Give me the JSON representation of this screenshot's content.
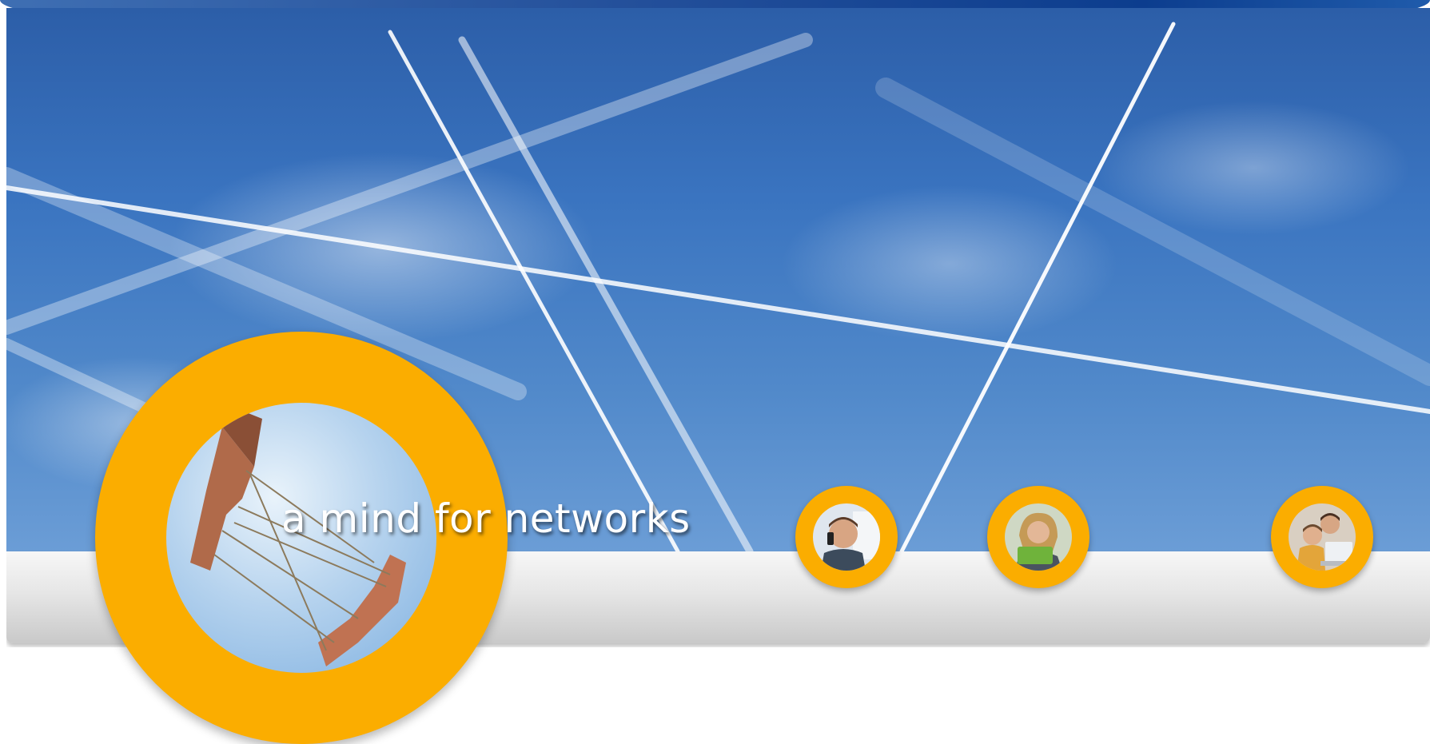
{
  "hero": {
    "tagline": "a mind for networks"
  },
  "colors": {
    "accent_ring": "#fbad00",
    "sky_blue": "#3a74c0",
    "bar_gray": "#e6e6e6",
    "band_blue": "#0c3d8e"
  },
  "icons": {
    "main_photo": "hands-string-network-photo",
    "person_1": "man-on-phone-photo",
    "person_2": "woman-with-tablet-photo",
    "person_3": "family-with-laptop-photo"
  }
}
